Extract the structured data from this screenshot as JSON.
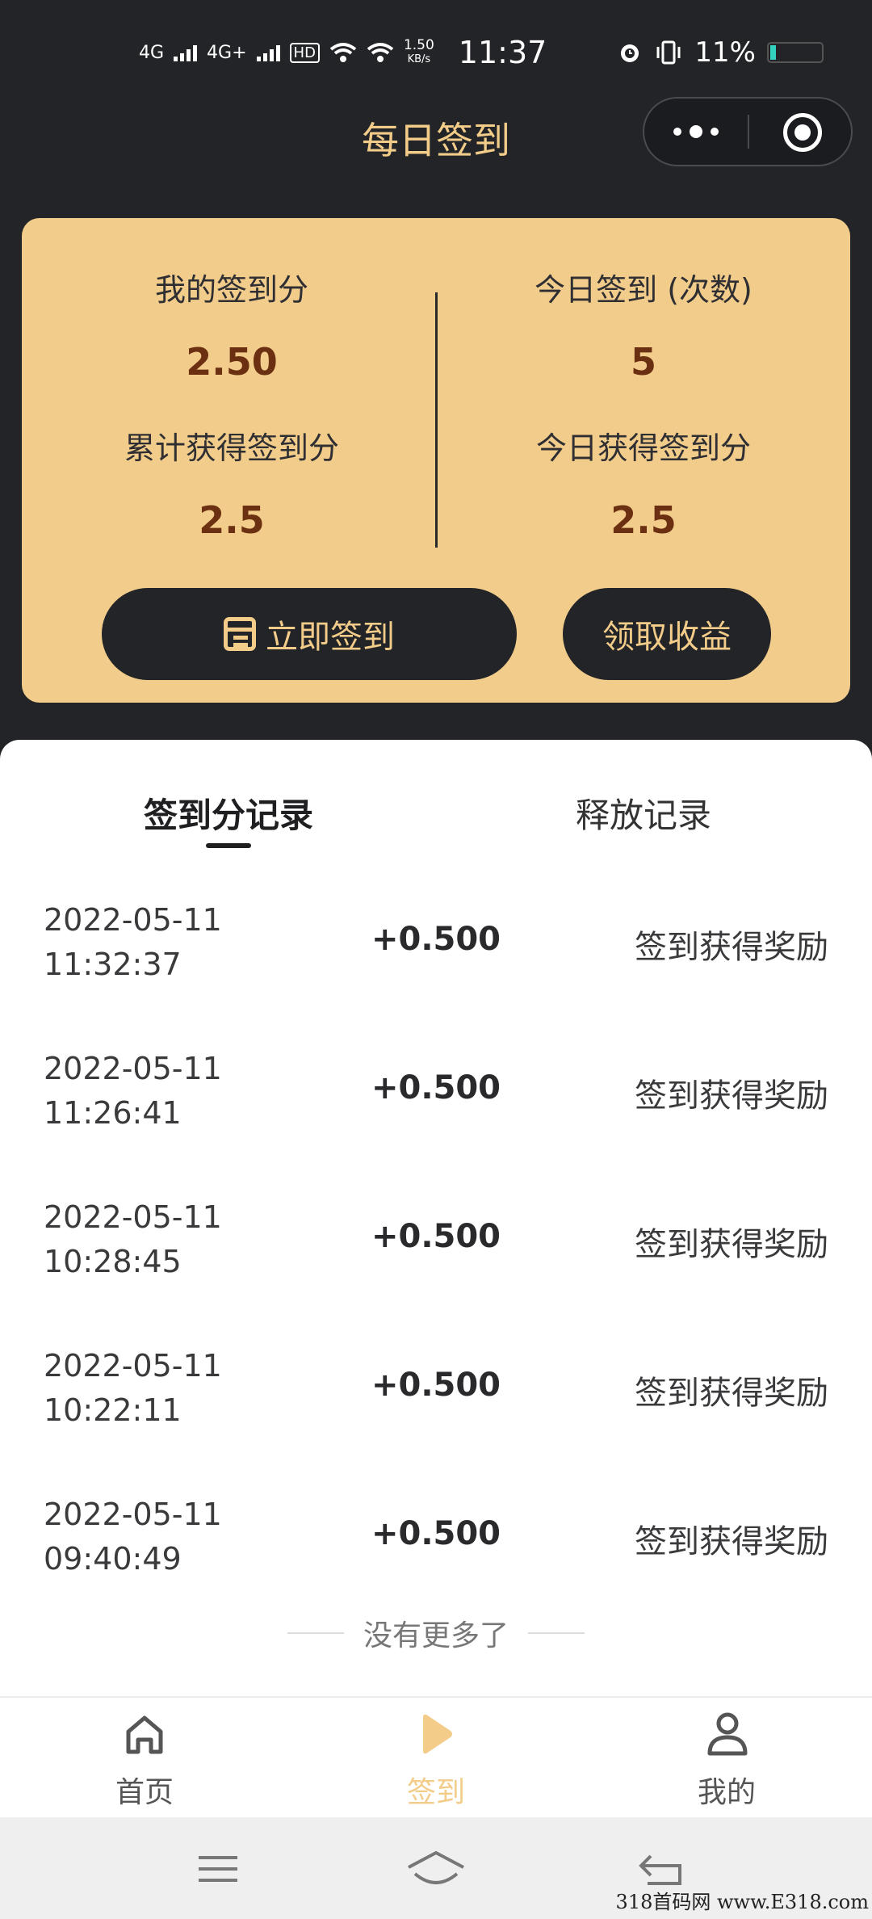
{
  "status_bar": {
    "network_1": "4G",
    "network_2": "4G+",
    "hd": "HD",
    "speed": "1.50",
    "speed_unit": "KB/s",
    "time": "11:37",
    "battery": "11%"
  },
  "header": {
    "title": "每日签到"
  },
  "card": {
    "my_points_label": "我的签到分",
    "my_points_value": "2.50",
    "today_count_label": "今日签到 (次数)",
    "today_count_value": "5",
    "total_earned_label": "累计获得签到分",
    "total_earned_value": "2.5",
    "today_earned_label": "今日获得签到分",
    "today_earned_value": "2.5",
    "sign_button": "立即签到",
    "claim_button": "领取收益"
  },
  "tabs": {
    "records": "签到分记录",
    "release": "释放记录"
  },
  "records": [
    {
      "date": "2022-05-11",
      "time": "11:32:37",
      "amount": "+0.500",
      "desc": "签到获得奖励"
    },
    {
      "date": "2022-05-11",
      "time": "11:26:41",
      "amount": "+0.500",
      "desc": "签到获得奖励"
    },
    {
      "date": "2022-05-11",
      "time": "10:28:45",
      "amount": "+0.500",
      "desc": "签到获得奖励"
    },
    {
      "date": "2022-05-11",
      "time": "10:22:11",
      "amount": "+0.500",
      "desc": "签到获得奖励"
    },
    {
      "date": "2022-05-11",
      "time": "09:40:49",
      "amount": "+0.500",
      "desc": "签到获得奖励"
    }
  ],
  "no_more": "没有更多了",
  "tabbar": {
    "home": "首页",
    "sign": "签到",
    "mine": "我的"
  },
  "watermark": "318首码网 www.E318.com",
  "colors": {
    "dark_bg": "#232428",
    "gold": "#f2cc8a",
    "gold_text": "#f2cc88",
    "value_brown": "#6b2f12"
  }
}
